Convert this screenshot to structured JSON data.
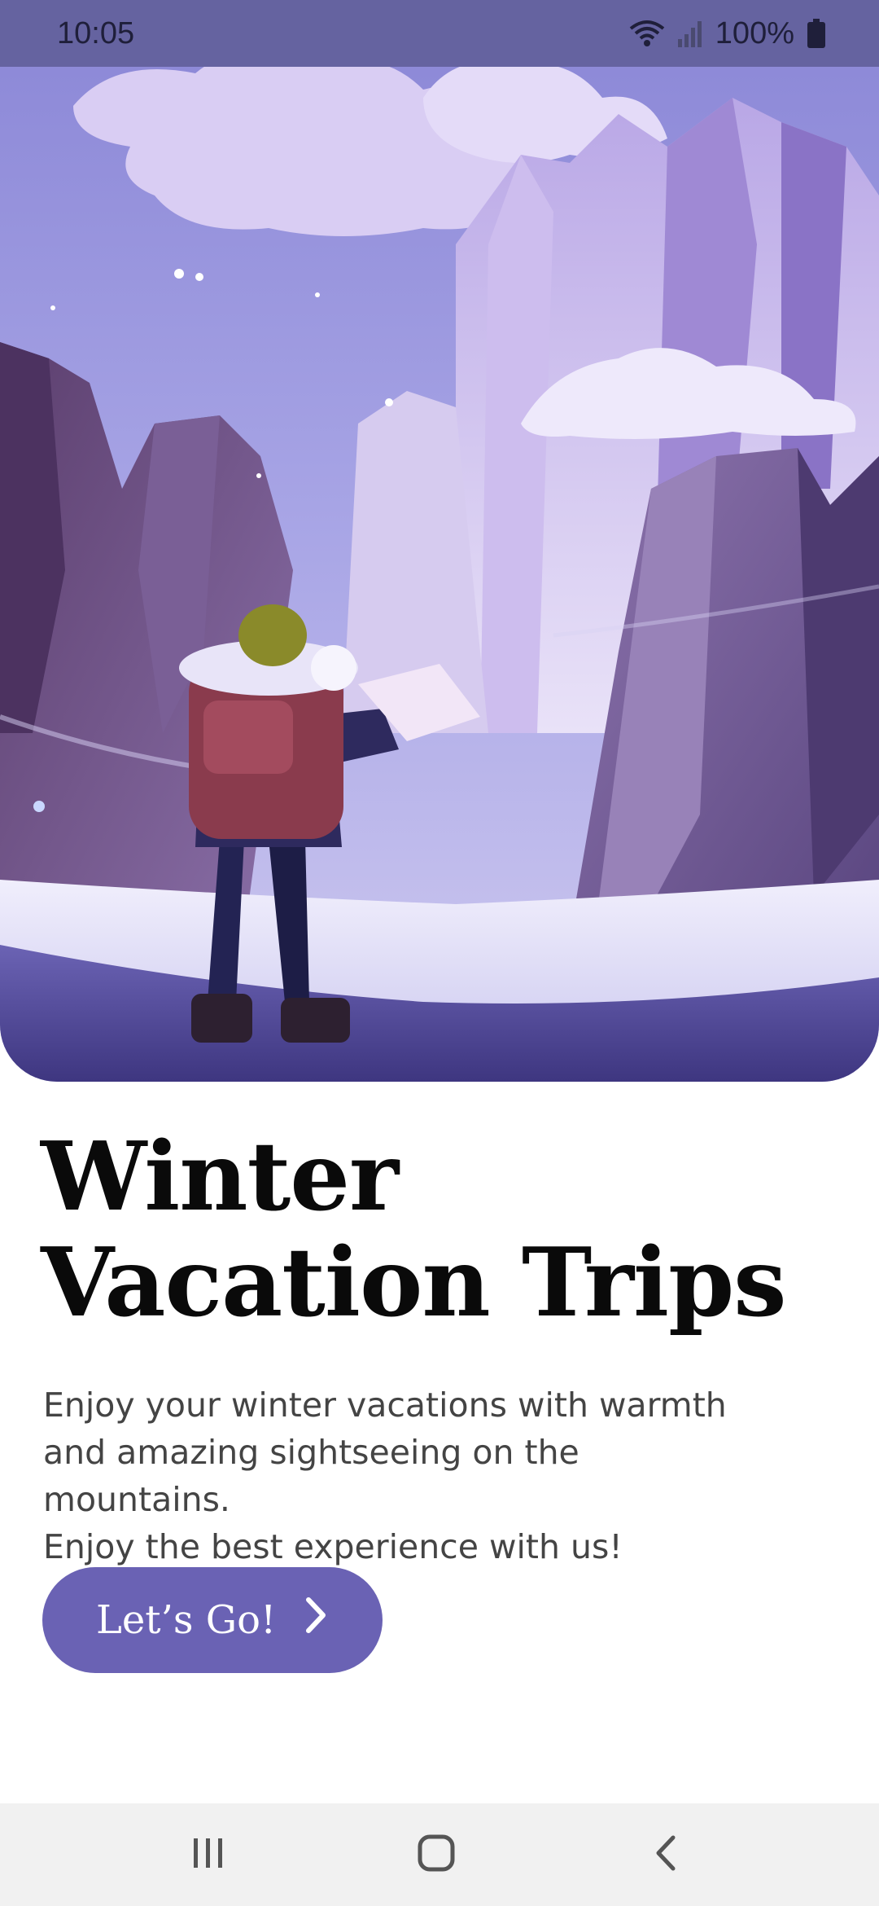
{
  "status_bar": {
    "time": "10:05",
    "battery_percent": "100%",
    "icons": [
      "wifi-icon",
      "signal-icon",
      "battery-icon"
    ]
  },
  "hero": {
    "illustration": "hiker-with-backpack-reading-map-in-purple-snowy-mountains"
  },
  "headline": {
    "line1": "Winter",
    "line2": "Vacation Trips"
  },
  "description": {
    "line1": "Enjoy your winter vacations with warmth",
    "line2": "and amazing sightseeing on the mountains.",
    "line3": "Enjoy the best experience with us!"
  },
  "cta": {
    "label": "Let’s Go!",
    "icon": "chevron-right-icon"
  },
  "nav_bar": {
    "buttons": [
      "recent-apps-icon",
      "home-icon",
      "back-icon"
    ]
  },
  "colors": {
    "status_bar": "#6563a0",
    "accent": "#6a62b4",
    "headline": "#0a0a0a",
    "body_text": "#444444",
    "nav_bar": "#f1f1f1"
  }
}
